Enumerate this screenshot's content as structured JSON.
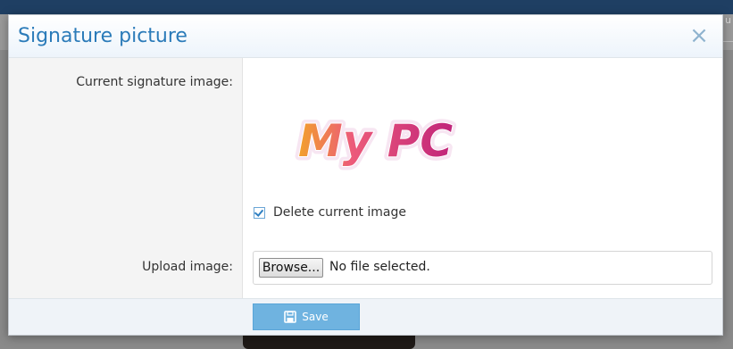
{
  "background": {
    "edge_text": "u"
  },
  "dialog": {
    "title": "Signature picture",
    "close_glyph": "×",
    "fields": {
      "current_label": "Current signature image:",
      "signature_text": "My PC",
      "delete_checkbox": {
        "label": "Delete current image",
        "checked": true
      },
      "upload_label": "Upload image:",
      "browse_label": "Browse...",
      "file_status": "No file selected."
    },
    "footer": {
      "save_label": "Save",
      "save_icon": "floppy-disk-icon"
    }
  },
  "colors": {
    "title": "#2b7bb9",
    "primary_button": "#6fb3e0",
    "checkbox": "#2e7fc1",
    "topbar": "#1f3f63"
  }
}
